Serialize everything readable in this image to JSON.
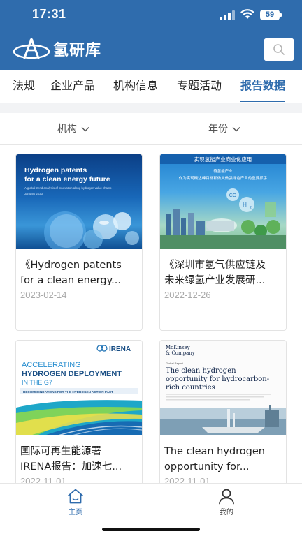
{
  "status_bar": {
    "time": "17:31",
    "battery": "59"
  },
  "app": {
    "name": "氢研库"
  },
  "tabs": [
    {
      "label": "法规",
      "active": false
    },
    {
      "label": "企业产品",
      "active": false
    },
    {
      "label": "机构信息",
      "active": false
    },
    {
      "label": "专题活动",
      "active": false
    },
    {
      "label": "报告数据",
      "active": true
    }
  ],
  "filters": {
    "institution": "机构",
    "year": "年份"
  },
  "reports": [
    {
      "title_line1": "《Hydrogen patents",
      "title_line2": "for a clean energy...",
      "date": "2023-02-14",
      "cover": {
        "heading_line1": "Hydrogen patents",
        "heading_line2": "for a clean energy future",
        "subtitle": "A global trend analysis of innovation along hydrogen value chains",
        "date": "January 2023"
      }
    },
    {
      "title_line1": "《深圳市氢气供应链及",
      "title_line2": "未来绿氢产业发展研...",
      "date": "2022-12-26",
      "cover": {
        "banner": "实现氢能产业商业化应用",
        "line1": "待氢能产业",
        "line2": "作为实现碳达峰目标和做大做强绿色产业的重要抓手",
        "bubble1": "CO",
        "bubble2": "H",
        "bubble3": "2"
      }
    },
    {
      "title_line1": "国际可再生能源署",
      "title_line2": "IRENA报告：加速七...",
      "date": "2022-11-01",
      "cover": {
        "brand": "IRENA",
        "line1": "ACCELERATING",
        "line2": "HYDROGEN DEPLOYMENT",
        "line3": "IN THE G7",
        "ribbon_text": "RECOMMENDATIONS FOR THE HYDROGEN ACTION PACT"
      }
    },
    {
      "title_line1": "The clean hydrogen",
      "title_line2": "opportunity for...",
      "date": "2022-11-01",
      "cover": {
        "brand_line1": "McKinsey",
        "brand_line2": "& Company",
        "kicker": "Global Report",
        "heading_line1": "The clean hydrogen",
        "heading_line2": "opportunity for hydrocarbon-",
        "heading_line3": "rich countries"
      }
    }
  ],
  "bottom_nav": [
    {
      "label": "主页",
      "icon": "home-icon",
      "active": true
    },
    {
      "label": "我的",
      "icon": "user-icon",
      "active": false
    }
  ],
  "colors": {
    "brand": "#2f6cad",
    "tab_active": "#2f6cad"
  }
}
